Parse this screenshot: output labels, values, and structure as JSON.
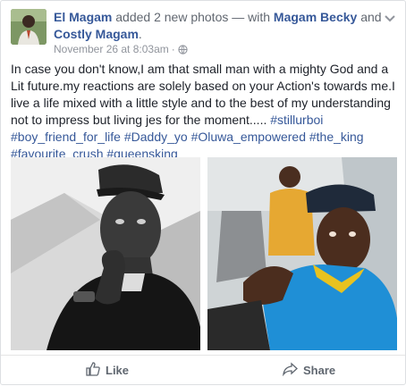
{
  "post": {
    "author": "El Magam",
    "action_text": " added 2 new photos — with ",
    "tag1": "Magam Becky",
    "and_text": " and ",
    "tag2": "Costly Magam",
    "end_text": ".",
    "timestamp": "November 26 at 8:03am",
    "separator": "·",
    "privacy_icon": "globe-icon",
    "menu_icon": "chevron-down-icon",
    "body": "In case you don't know,I am that small man with a mighty God and a Lit future.my reactions are solely based on your Action's towards me.I live a life mixed with a little style and to the best of my understanding not to impress but living jes for the moment.....",
    "hashtags": "#stillurboi #boy_friend_for_life #Daddy_yo #Oluwa_empowered #the_king #favourite_crush #queensking"
  },
  "photos": [
    {
      "description": "black-and-white selfie of a man in a cap",
      "style": "grayscale"
    },
    {
      "description": "color selfie of a man in a cap and blue shirt",
      "style": "color"
    }
  ],
  "actions": {
    "like_label": "Like",
    "like_icon": "thumbs-up-icon",
    "share_label": "Share",
    "share_icon": "share-arrow-icon"
  },
  "colors": {
    "link": "#365899",
    "meta": "#90949c",
    "action": "#606770"
  }
}
